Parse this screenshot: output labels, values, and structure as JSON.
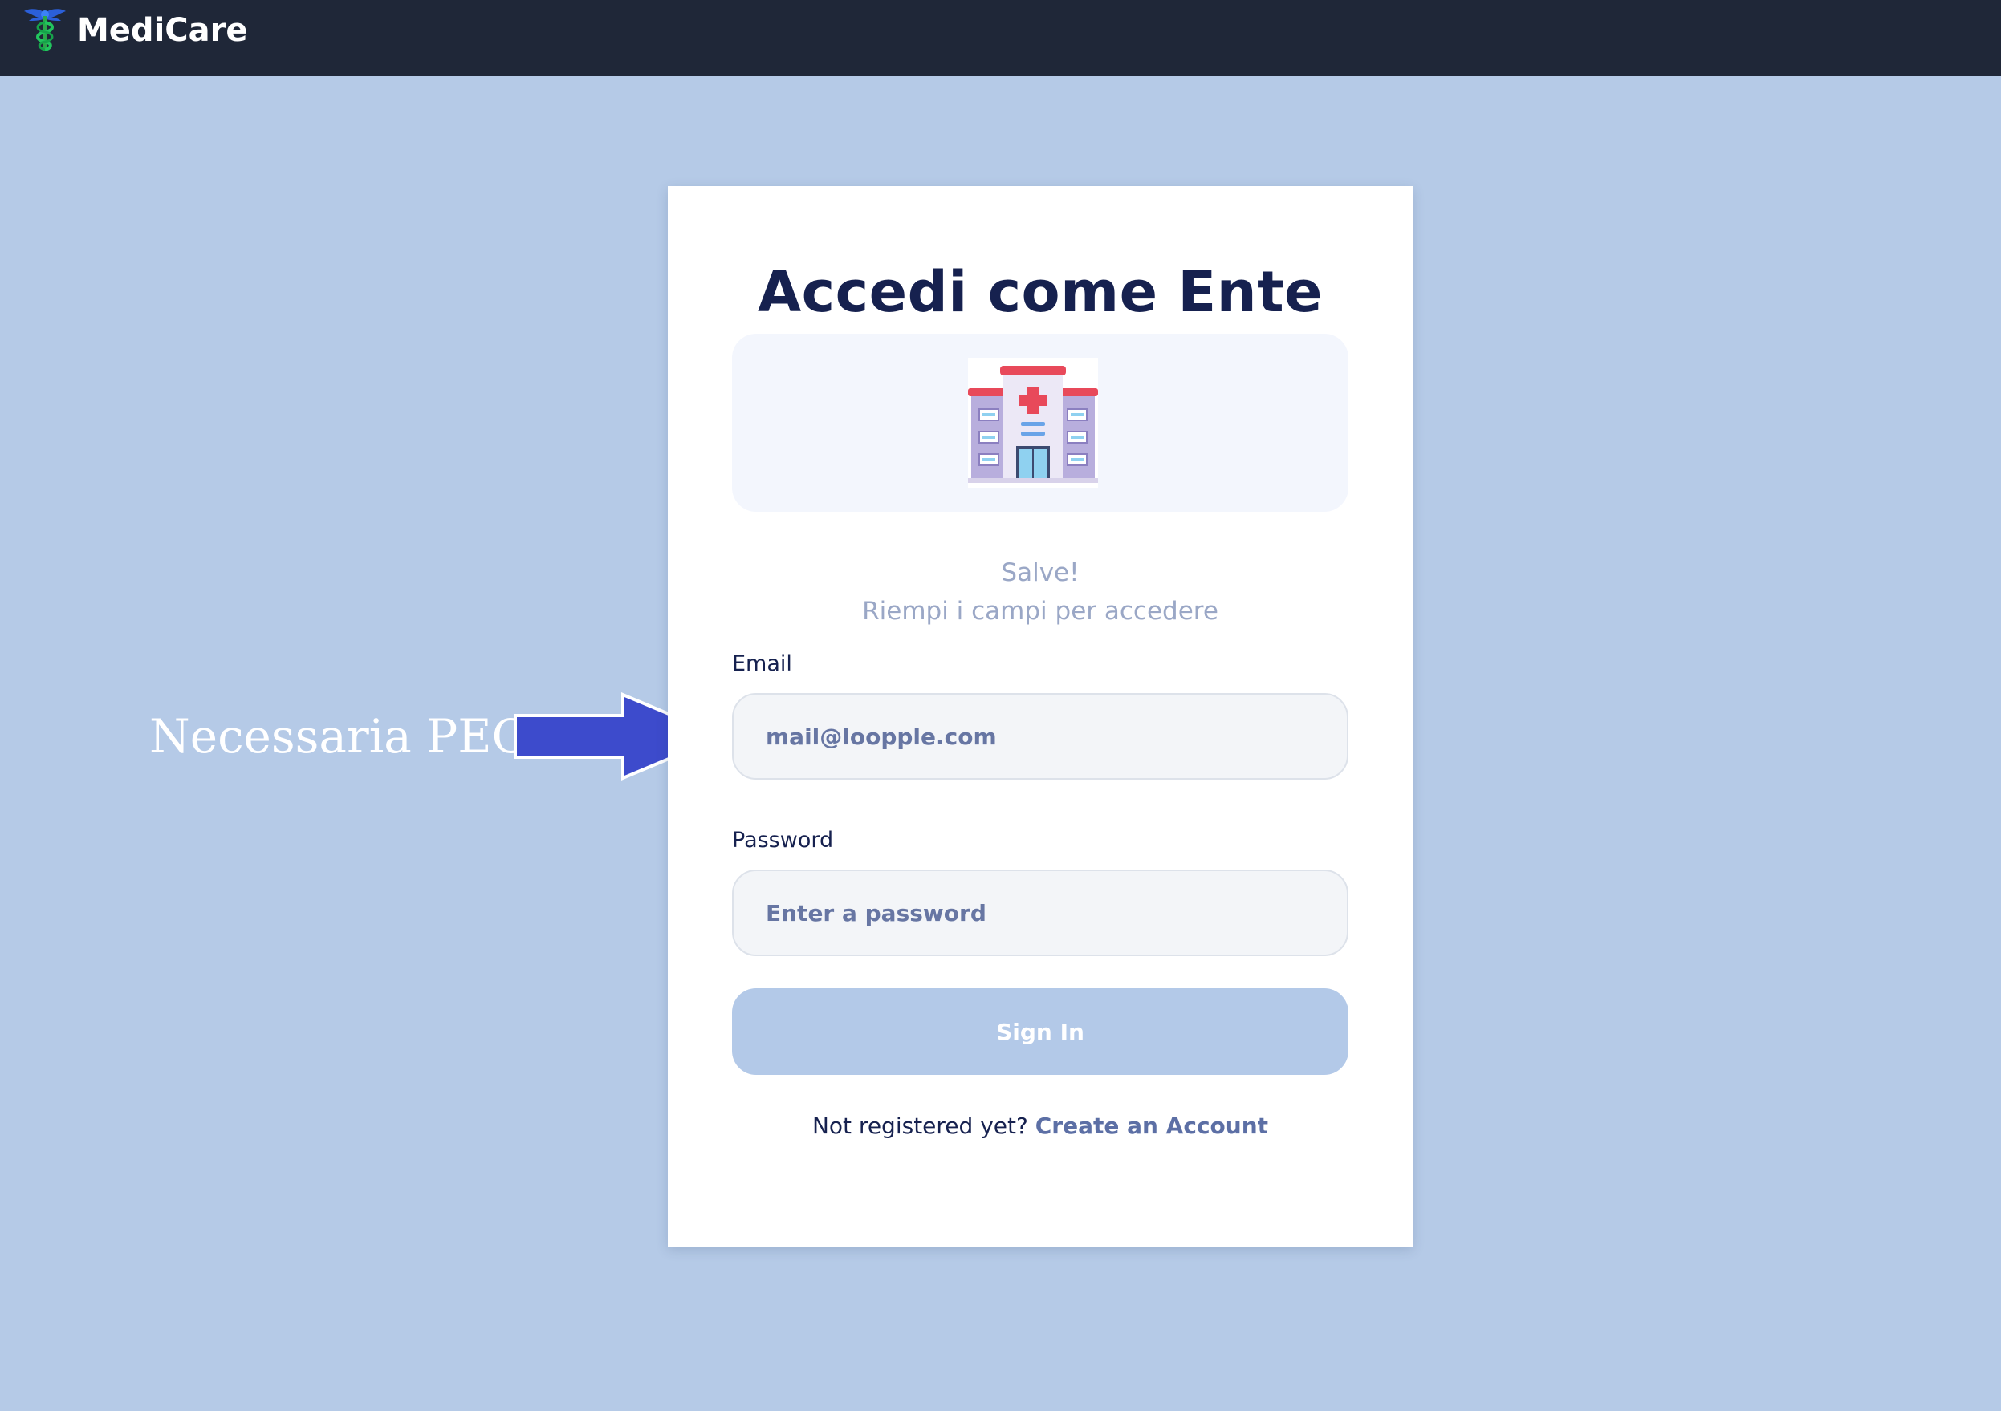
{
  "header": {
    "brand_name": "MediCare",
    "logo_icon": "caduceus-icon",
    "background_color": "#1f2738"
  },
  "annotation": {
    "text": "Necessaria PEC",
    "arrow_icon": "right-arrow-icon",
    "arrow_color": "#3d4bcc"
  },
  "login": {
    "title": "Accedi come Ente",
    "illustration_icon": "hospital-icon",
    "greeting": "Salve!",
    "subtitle": "Riempi i campi per accedere",
    "email_label": "Email",
    "email_placeholder": "mail@loopple.com",
    "password_label": "Password",
    "password_placeholder": "Enter a password",
    "sign_in_label": "Sign In",
    "register_prompt": "Not registered yet?",
    "register_link": "Create an Account"
  },
  "colors": {
    "page_background": "#b5cae7",
    "title": "#16214f",
    "muted_text": "#9aa7c6",
    "link": "#5c6fa5",
    "button": "#b3c9e8"
  }
}
